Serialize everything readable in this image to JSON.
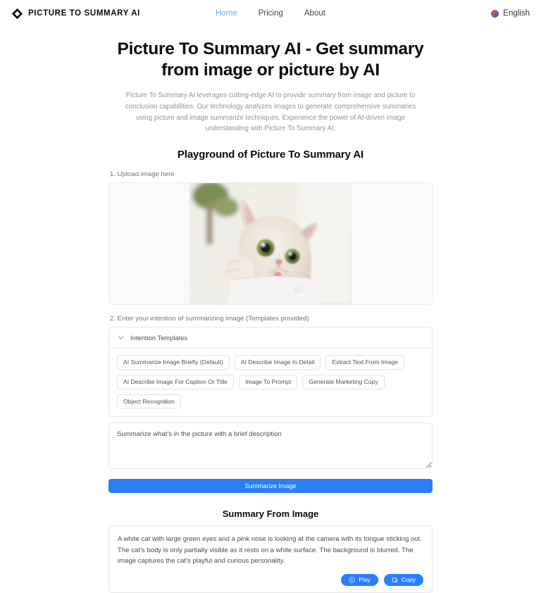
{
  "navbar": {
    "brand_text": "PICTURE TO SUMMARY AI",
    "logo_icon": "diamond-logo-icon",
    "links": [
      {
        "label": "Home",
        "active": true
      },
      {
        "label": "Pricing",
        "active": false
      },
      {
        "label": "About",
        "active": false
      }
    ],
    "language": {
      "label": "English",
      "flag_icon": "flag-icon"
    }
  },
  "hero": {
    "title": "Picture To Summary AI - Get summary from image or picture by AI",
    "description": "Picture To Summary AI leverages cutting-edge AI to provide summary from image and picture to conclusion capabilities. Our technology analyzes images to generate comprehensive summaries using picture and image summarize techniques. Experience the power of AI-driven image understanding with Picture To Summary AI."
  },
  "playground": {
    "section_title": "Playground of Picture To Summary AI",
    "step1_label": "1. Upload image here",
    "uploaded_image_alt": "Cream colored cat with large green eyes looking at camera with tongue out",
    "step2_label": "2. Enter your intention of summarizing image (Templates provided)",
    "templates": {
      "header_label": "Intention Templates",
      "chevron_icon": "chevron-down-icon",
      "chips": [
        "AI Summarize Image Briefly (Default)",
        "AI Describe Image In Detail",
        "Extract Text From Image",
        "AI Describe Image For Caption Or Title",
        "Image To Prompt",
        "Generate Marketing Copy",
        "Object Recognition"
      ]
    },
    "intent_input": {
      "value": "Summarize what's in the picture with a brief description",
      "placeholder": "Summarize what's in the picture with a brief description"
    },
    "submit_label": "Summarize Image"
  },
  "summary": {
    "title": "Summary From Image",
    "text": "A white cat with large green eyes and a pink nose is looking at the camera with its tongue sticking out. The cat's body is only partially visible as it rests on a white surface. The background is blurred. The image captures the cat's playful and curious personality.",
    "actions": [
      {
        "label": "Play",
        "icon": "play-circle-icon"
      },
      {
        "label": "Copy",
        "icon": "copy-icon"
      }
    ]
  },
  "colors": {
    "accent_blue": "#2b7fff",
    "nav_active": "#6aa8f7",
    "text_primary": "#0b0b0e",
    "text_muted": "#8e949d",
    "border": "#e8e8ec",
    "upload_bg": "#fafafa"
  }
}
